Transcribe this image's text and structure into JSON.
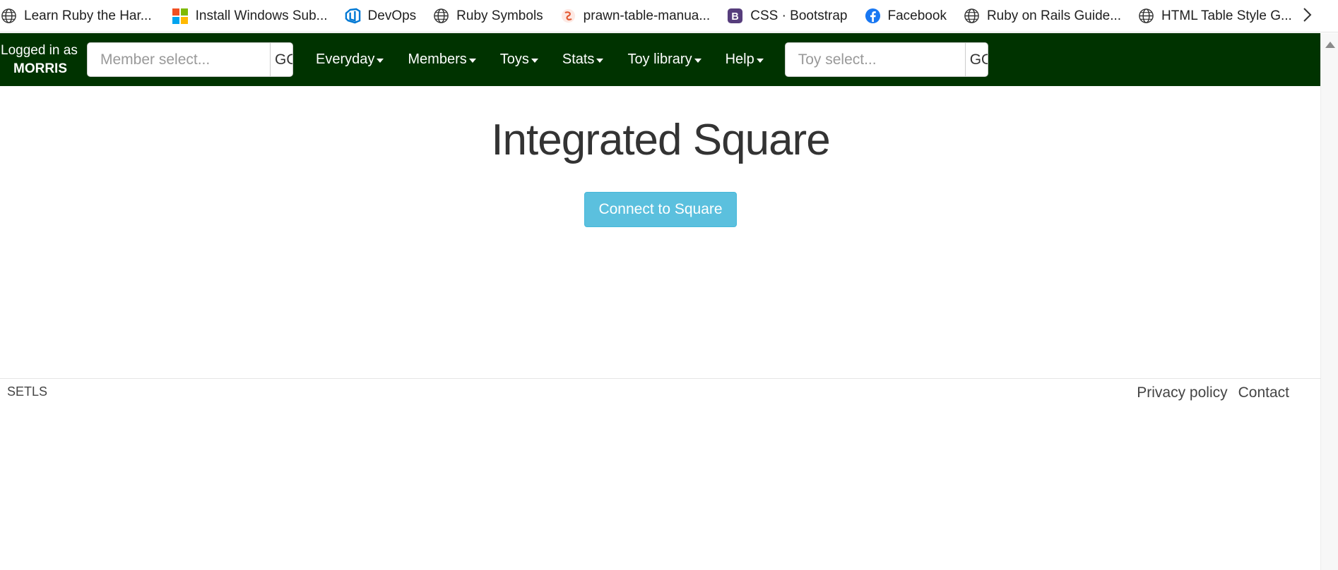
{
  "bookmarks": [
    {
      "label": "Learn Ruby the Har...",
      "icon": "globe-icon"
    },
    {
      "label": "Install Windows Sub...",
      "icon": "microsoft-logo-icon"
    },
    {
      "label": "DevOps",
      "icon": "azure-devops-icon"
    },
    {
      "label": "Ruby Symbols",
      "icon": "globe-icon"
    },
    {
      "label": "prawn-table-manua...",
      "icon": "swirl-logo-icon"
    },
    {
      "label": "CSS · Bootstrap",
      "icon": "bootstrap-logo-icon"
    },
    {
      "label": "Facebook",
      "icon": "facebook-logo-icon"
    },
    {
      "label": "Ruby on Rails Guide...",
      "icon": "globe-icon"
    },
    {
      "label": "HTML Table Style G...",
      "icon": "globe-icon"
    }
  ],
  "navbar": {
    "logged_in_label": "Logged in as",
    "username": "MORRIS",
    "member_search": {
      "placeholder": "Member select...",
      "go_label": "GO"
    },
    "menu": [
      {
        "label": "Everyday"
      },
      {
        "label": "Members"
      },
      {
        "label": "Toys"
      },
      {
        "label": "Stats"
      },
      {
        "label": "Toy library"
      },
      {
        "label": "Help"
      }
    ],
    "toy_search": {
      "placeholder": "Toy select...",
      "go_label": "GO"
    },
    "background_color": "#003300"
  },
  "main": {
    "title": "Integrated Square",
    "connect_button_label": "Connect to Square",
    "button_color": "#5bc0de"
  },
  "footer": {
    "left_text": "SETLS",
    "links": [
      {
        "label": "Privacy policy"
      },
      {
        "label": "Contact"
      }
    ]
  }
}
